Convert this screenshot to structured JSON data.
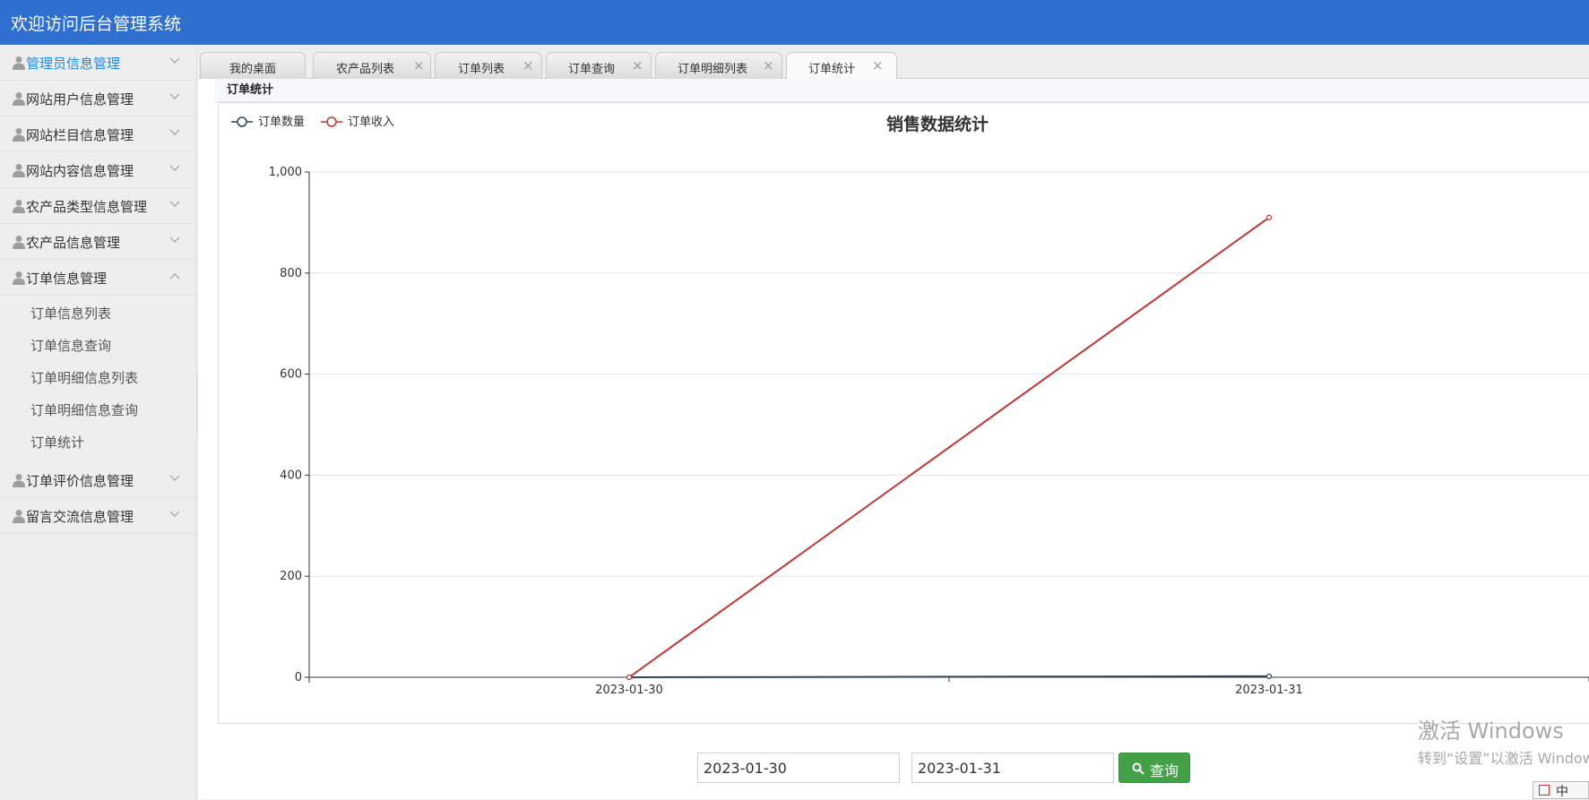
{
  "header": {
    "title": "欢迎访问后台管理系统"
  },
  "sidebar": {
    "items": [
      {
        "label": "管理员信息管理",
        "active": true,
        "expanded": false
      },
      {
        "label": "网站用户信息管理",
        "expanded": false
      },
      {
        "label": "网站栏目信息管理",
        "expanded": false
      },
      {
        "label": "网站内容信息管理",
        "expanded": false
      },
      {
        "label": "农产品类型信息管理",
        "expanded": false
      },
      {
        "label": "农产品信息管理",
        "expanded": false
      },
      {
        "label": "订单信息管理",
        "expanded": true,
        "children": [
          "订单信息列表",
          "订单信息查询",
          "订单明细信息列表",
          "订单明细信息查询",
          "订单统计"
        ]
      },
      {
        "label": "订单评价信息管理",
        "expanded": false
      },
      {
        "label": "留言交流信息管理",
        "expanded": false
      }
    ]
  },
  "tabs": [
    {
      "label": "我的桌面",
      "closable": false
    },
    {
      "label": "农产品列表",
      "closable": true
    },
    {
      "label": "订单列表",
      "closable": true
    },
    {
      "label": "订单查询",
      "closable": true
    },
    {
      "label": "订单明细列表",
      "closable": true
    },
    {
      "label": "订单统计",
      "closable": true,
      "active": true
    }
  ],
  "tab_close_glyph": "×",
  "panel": {
    "title": "订单统计"
  },
  "chart_data": {
    "type": "line",
    "title": "销售数据统计",
    "x": [
      "2023-01-30",
      "2023-01-31"
    ],
    "series": [
      {
        "name": "订单数量",
        "values": [
          0,
          2
        ],
        "color": "#2f4554"
      },
      {
        "name": "订单收入",
        "values": [
          0,
          910
        ],
        "color": "#c23531"
      }
    ],
    "ylim": [
      0,
      1000
    ],
    "yticks": [
      0,
      200,
      400,
      600,
      800,
      1000
    ],
    "ytick_labels": [
      "0",
      "200",
      "400",
      "600",
      "800",
      "1,000"
    ],
    "grid": true,
    "legend": "top-left"
  },
  "query": {
    "start_date": "2023-01-30",
    "end_date": "2023-01-31",
    "button_label": "查询",
    "button_color": "#43a047"
  },
  "watermark": {
    "line1": "激活 Windows",
    "line2": "转到“设置”以激活 Windows。"
  },
  "ime": {
    "label": "中"
  },
  "colors": {
    "header": "#2f6fcf",
    "active_menu": "#1e88e5"
  }
}
